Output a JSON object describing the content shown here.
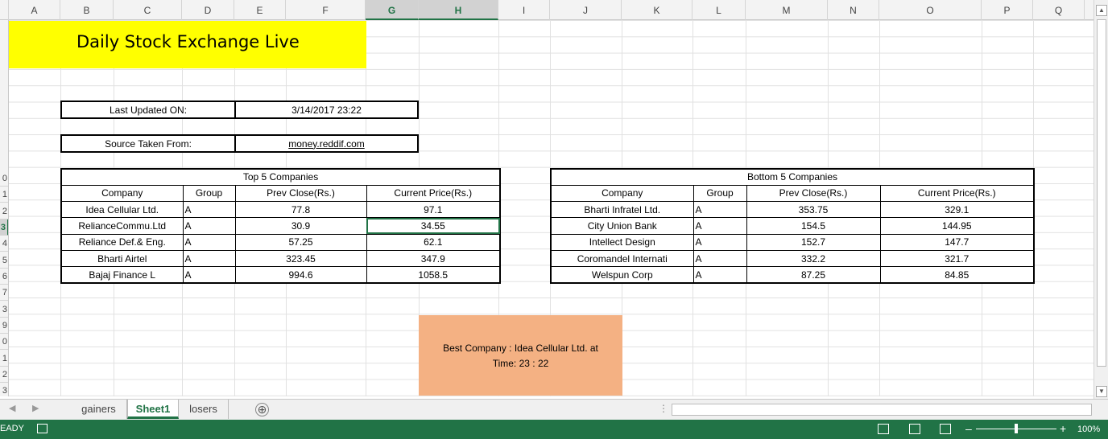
{
  "columns": [
    "A",
    "B",
    "C",
    "D",
    "E",
    "F",
    "G",
    "H",
    "I",
    "J",
    "K",
    "L",
    "M",
    "N",
    "O",
    "P",
    "Q"
  ],
  "rows": [
    "",
    "",
    "",
    "",
    "",
    "",
    "",
    "",
    "",
    "0",
    "1",
    "2",
    "3",
    "4",
    "5",
    "6",
    "7",
    "3",
    "9",
    "0",
    "1",
    "2",
    "3"
  ],
  "title": "Daily Stock Exchange Live",
  "last_updated": {
    "label": "Last Updated ON:",
    "value": "3/14/2017 23:22"
  },
  "source": {
    "label": "Source Taken From:",
    "value": "money.reddif.com"
  },
  "top": {
    "title": "Top 5 Companies",
    "headers": [
      "Company",
      "Group",
      "Prev Close(Rs.)",
      "Current Price(Rs.)"
    ],
    "rows": [
      [
        "Idea Cellular Ltd.",
        "A",
        "77.8",
        "97.1"
      ],
      [
        "RelianceCommu.Ltd",
        "A",
        "30.9",
        "34.55"
      ],
      [
        "Reliance Def.& Eng.",
        "A",
        "57.25",
        "62.1"
      ],
      [
        "Bharti Airtel",
        "A",
        "323.45",
        "347.9"
      ],
      [
        "Bajaj Finance L",
        "A",
        "994.6",
        "1058.5"
      ]
    ]
  },
  "bottom": {
    "title": "Bottom 5 Companies",
    "headers": [
      "Company",
      "Group",
      "Prev Close(Rs.)",
      "Current Price(Rs.)"
    ],
    "rows": [
      [
        "Bharti Infratel Ltd.",
        "A",
        "353.75",
        "329.1"
      ],
      [
        "City Union Bank",
        "A",
        "154.5",
        "144.95"
      ],
      [
        "Intellect Design",
        "A",
        "152.7",
        "147.7"
      ],
      [
        "Coromandel Internati",
        "A",
        "332.2",
        "321.7"
      ],
      [
        "Welspun Corp",
        "A",
        "87.25",
        "84.85"
      ]
    ]
  },
  "best": {
    "line1": "Best Company : Idea Cellular Ltd.  at",
    "line2": "Time: 23 : 22"
  },
  "tabs": [
    "gainers",
    "Sheet1",
    "losers"
  ],
  "add_sheet": "⊕",
  "status": {
    "ready": "EADY",
    "zoom": "100%"
  },
  "colors": {
    "title_bg": "#ffff00",
    "best_bg": "#f4b183",
    "accent": "#217346"
  }
}
